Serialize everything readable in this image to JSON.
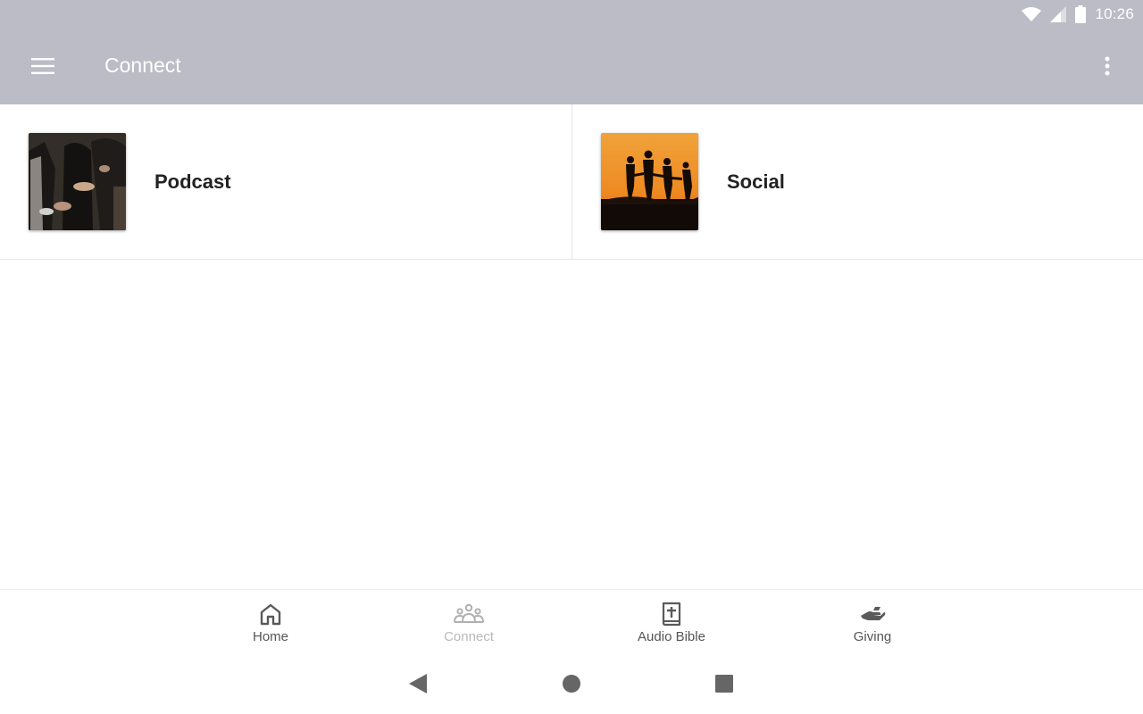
{
  "status_bar": {
    "time": "10:26"
  },
  "app_bar": {
    "title": "Connect"
  },
  "tiles": [
    {
      "label": "Podcast"
    },
    {
      "label": "Social"
    }
  ],
  "bottom_nav": {
    "items": [
      {
        "label": "Home",
        "icon": "home-icon"
      },
      {
        "label": "Connect",
        "icon": "people-icon",
        "active": true
      },
      {
        "label": "Audio Bible",
        "icon": "bible-icon"
      },
      {
        "label": "Giving",
        "icon": "giving-hand-icon"
      }
    ]
  },
  "colors": {
    "app_bar": "#bbbcc5",
    "text_dark": "#222222",
    "inactive_label": "#555555",
    "active_label": "#b9b9b9"
  }
}
